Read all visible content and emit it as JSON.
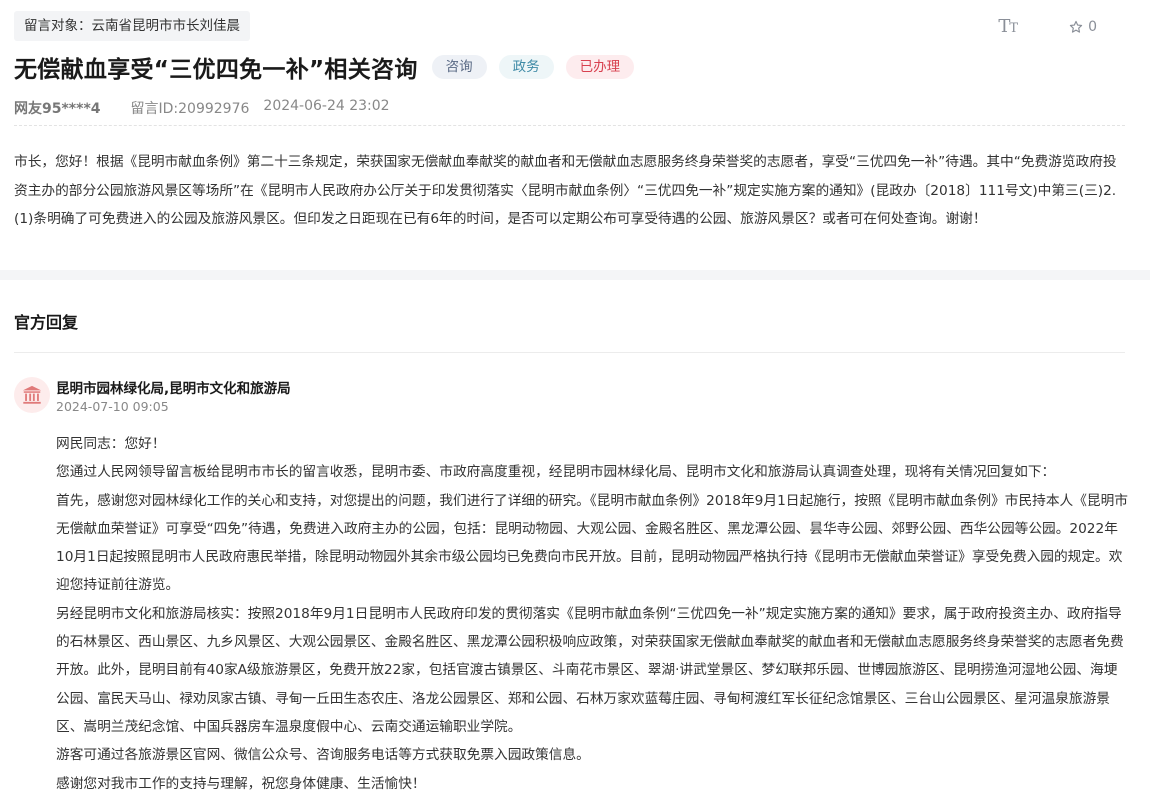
{
  "header": {
    "recipient_label": "留言对象：云南省昆明市市长刘佳晨",
    "font_size_icon": "Tт",
    "favorite_count": "0"
  },
  "message": {
    "title": "无偿献血享受“三优四免一补”相关咨询",
    "tags": [
      "咨询",
      "政务",
      "已办理"
    ],
    "author": "网友95****4",
    "message_id": "留言ID:20992976",
    "datetime": "2024-06-24 23:02",
    "content": "市长，您好！根据《昆明市献血条例》第二十三条规定，荣获国家无偿献血奉献奖的献血者和无偿献血志愿服务终身荣誉奖的志愿者，享受“三优四免一补”待遇。其中“免费游览政府投资主办的部分公园旅游风景区等场所”在《昆明市人民政府办公厅关于印发贯彻落实〈昆明市献血条例〉“三优四免一补”规定实施方案的通知》(昆政办〔2018〕111号文)中第三(三)2.(1)条明确了可免费进入的公园及旅游风景区。但印发之日距现在已有6年的时间，是否可以定期公布可享受待遇的公园、旅游风景区？或者可在何处查询。谢谢！"
  },
  "reply": {
    "section_title": "官方回复",
    "department": "昆明市园林绿化局,昆明市文化和旅游局",
    "datetime": "2024-07-10 09:05",
    "paragraphs": [
      "网民同志：您好！",
      "您通过人民网领导留言板给昆明市市长的留言收悉，昆明市委、市政府高度重视，经昆明市园林绿化局、昆明市文化和旅游局认真调查处理，现将有关情况回复如下：",
      "首先，感谢您对园林绿化工作的关心和支持，对您提出的问题，我们进行了详细的研究。《昆明市献血条例》2018年9月1日起施行，按照《昆明市献血条例》市民持本人《昆明市无偿献血荣誉证》可享受“四免”待遇，免费进入政府主办的公园，包括：昆明动物园、大观公园、金殿名胜区、黑龙潭公园、昙华寺公园、郊野公园、西华公园等公园。2022年10月1日起按照昆明市人民政府惠民举措，除昆明动物园外其余市级公园均已免费向市民开放。目前，昆明动物园严格执行持《昆明市无偿献血荣誉证》享受免费入园的规定。欢迎您持证前往游览。",
      "另经昆明市文化和旅游局核实：按照2018年9月1日昆明市人民政府印发的贯彻落实《昆明市献血条例“三优四免一补”规定实施方案的通知》要求，属于政府投资主办、政府指导的石林景区、西山景区、九乡风景区、大观公园景区、金殿名胜区、黑龙潭公园积极响应政策，对荣获国家无偿献血奉献奖的献血者和无偿献血志愿服务终身荣誉奖的志愿者免费开放。此外，昆明目前有40家A级旅游景区，免费开放22家，包括官渡古镇景区、斗南花市景区、翠湖·讲武堂景区、梦幻联邦乐园、世博园旅游区、昆明捞渔河湿地公园、海埂公园、富民天马山、禄劝凤家古镇、寻甸一丘田生态农庄、洛龙公园景区、郑和公园、石林万家欢蓝莓庄园、寻甸柯渡红军长征纪念馆景区、三台山公园景区、星河温泉旅游景区、嵩明兰茂纪念馆、中国兵器房车温泉度假中心、云南交通运输职业学院。",
      "游客可通过各旅游景区官网、微信公众号、咨询服务电话等方式获取免票入园政策信息。",
      "感谢您对我市工作的支持与理解，祝您身体健康、生活愉快！"
    ]
  }
}
